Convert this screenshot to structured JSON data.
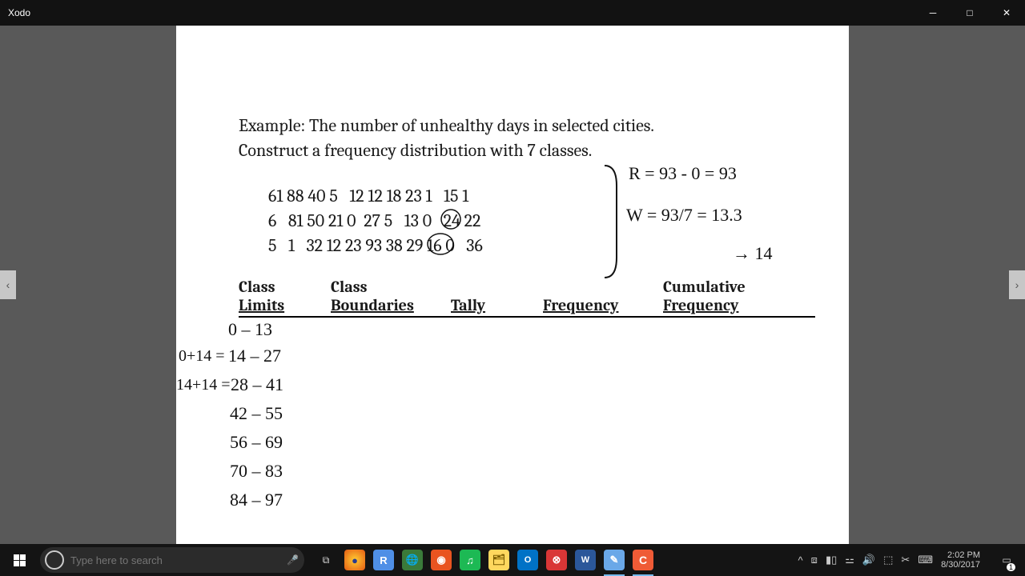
{
  "titlebar": {
    "app_name": "Xodo"
  },
  "document": {
    "prompt_line1": "Example: The number of unhealthy days in selected cities.",
    "prompt_line2": "Construct a frequency distribution with 7 classes.",
    "data_row1": "61 88 40 5   12 12 18 23 1   15 1",
    "data_row2": "6   81 50 21 0  27 5   13 0   24 22",
    "data_row3": "5   1   32 12 23 93 38 29 16 0   36",
    "headers": {
      "limits1": "Class",
      "limits2": "Limits",
      "bounds1": "Class",
      "bounds2": "Boundaries",
      "tally": "Tally",
      "freq": "Frequency",
      "cfreq1": "Cumulative",
      "cfreq2": "Frequency"
    }
  },
  "handwriting": {
    "range": "R = 93 - 0 = 93",
    "width": "W = 93/7 = 13.3",
    "width_round": "→ 14",
    "cl1": "0  – 13",
    "cl2a": "0+14 =",
    "cl2b": "14 – 27",
    "cl3a": "14+14 =",
    "cl3b": "28 – 41",
    "cl4": "42 – 55",
    "cl5": "56 – 69",
    "cl6": "70 – 83",
    "cl7": "84 – 97"
  },
  "taskbar": {
    "search_placeholder": "Type here to search",
    "time": "2:02 PM",
    "date": "8/30/2017",
    "notif_count": "1"
  }
}
